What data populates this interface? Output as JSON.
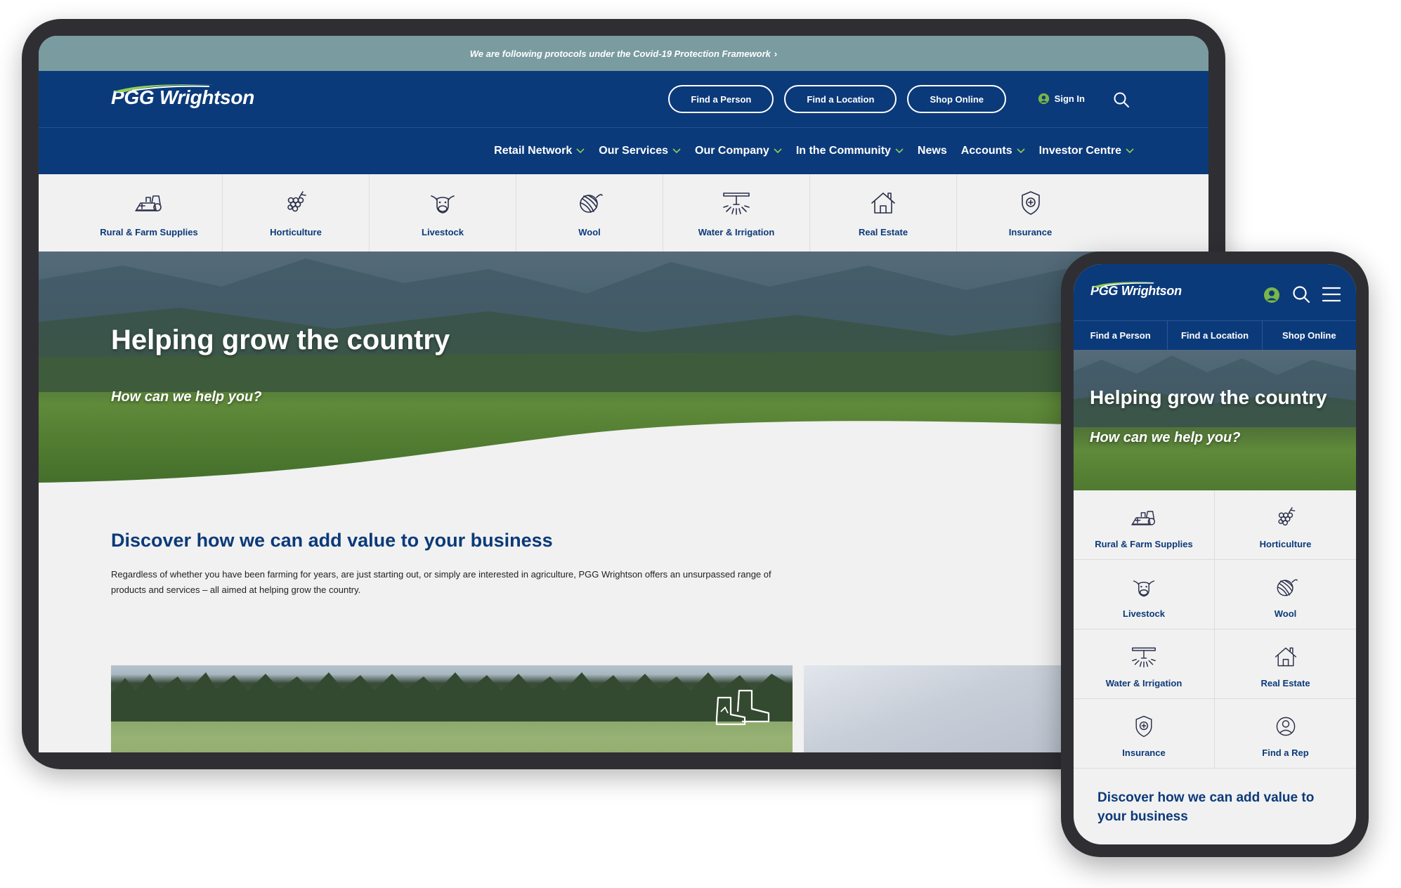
{
  "brand": {
    "name": "PGG Wrightson",
    "colors": {
      "navy": "#0b3a7a",
      "alert": "#7a9ba0",
      "accent_green": "#7ab648",
      "swoosh": "#8fcf55"
    }
  },
  "tablet": {
    "alert": {
      "text": "We are following protocols under the Covid-19 Protection Framework",
      "chevron": "›"
    },
    "header": {
      "pills": [
        "Find a Person",
        "Find a Location",
        "Shop Online"
      ],
      "sign_in": "Sign In",
      "icons": [
        "user-circle-icon",
        "search-icon"
      ]
    },
    "nav": [
      {
        "label": "Retail Network",
        "dropdown": true
      },
      {
        "label": "Our Services",
        "dropdown": true
      },
      {
        "label": "Our Company",
        "dropdown": true
      },
      {
        "label": "In the Community",
        "dropdown": true
      },
      {
        "label": "News",
        "dropdown": false
      },
      {
        "label": "Accounts",
        "dropdown": true
      },
      {
        "label": "Investor Centre",
        "dropdown": true
      }
    ],
    "categories": [
      {
        "label": "Rural & Farm Supplies",
        "icon": "farm-supplies-icon"
      },
      {
        "label": "Horticulture",
        "icon": "grapes-icon"
      },
      {
        "label": "Livestock",
        "icon": "cow-icon"
      },
      {
        "label": "Wool",
        "icon": "wool-ball-icon"
      },
      {
        "label": "Water & Irrigation",
        "icon": "sprinkler-icon"
      },
      {
        "label": "Real Estate",
        "icon": "house-icon"
      },
      {
        "label": "Insurance",
        "icon": "shield-icon"
      }
    ],
    "hero": {
      "title": "Helping grow the country",
      "subtitle": "How can we help you?"
    },
    "section": {
      "title": "Discover how we can add value to your business",
      "body": "Regardless of whether you have been farming for years, are just starting out, or simply are interested in agriculture, PGG Wrightson offers an unsurpassed range of products and services – all aimed at helping grow the country."
    }
  },
  "phone": {
    "icons": [
      "user-circle-icon",
      "search-icon",
      "hamburger-menu-icon"
    ],
    "links": [
      "Find a Person",
      "Find a Location",
      "Shop Online"
    ],
    "hero": {
      "title": "Helping grow the country",
      "subtitle": "How can we help you?"
    },
    "categories": [
      {
        "label": "Rural & Farm Supplies",
        "icon": "farm-supplies-icon"
      },
      {
        "label": "Horticulture",
        "icon": "grapes-icon"
      },
      {
        "label": "Livestock",
        "icon": "cow-icon"
      },
      {
        "label": "Wool",
        "icon": "wool-ball-icon"
      },
      {
        "label": "Water & Irrigation",
        "icon": "sprinkler-icon"
      },
      {
        "label": "Real Estate",
        "icon": "house-icon"
      },
      {
        "label": "Insurance",
        "icon": "shield-icon"
      },
      {
        "label": "Find a Rep",
        "icon": "person-circle-icon"
      }
    ],
    "section_title": "Discover how we can add value to your business"
  }
}
